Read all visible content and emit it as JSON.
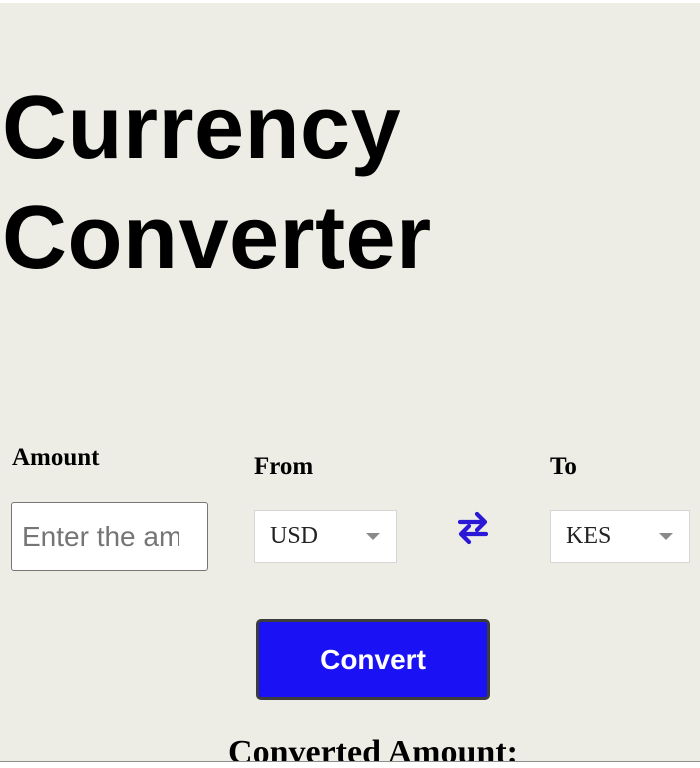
{
  "header": {
    "title_line1": "Currency",
    "title_line2": "Converter"
  },
  "amount": {
    "label": "Amount",
    "placeholder": "Enter the amount",
    "value": ""
  },
  "from": {
    "label": "From",
    "selected": "USD"
  },
  "to": {
    "label": "To",
    "selected": "KES"
  },
  "swap": {
    "icon": "swap-arrows-icon",
    "color": "#2b17d6"
  },
  "convert": {
    "label": "Convert",
    "color": "#1a12f5"
  },
  "result": {
    "heading": "Converted Amount:"
  }
}
